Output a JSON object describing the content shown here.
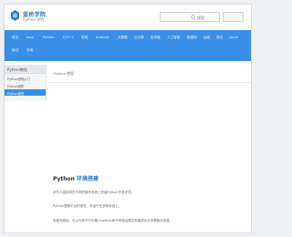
{
  "header": {
    "logo_cn": "蓝桥学院",
    "logo_en": "Python 学院",
    "search_placeholder": "搜索",
    "search_button": ""
  },
  "nav": {
    "items": [
      "首页",
      "Java",
      "Python",
      "C/C++",
      "前端",
      "Android",
      "大数据",
      "云计算",
      "区块链",
      "人工智能",
      "数据库",
      "运维",
      "测试",
      "Linux",
      "面试",
      "其他"
    ]
  },
  "sidebar": {
    "title": "Python教程",
    "items": [
      "Python基础入门",
      "Python进阶",
      "Python爬虫"
    ]
  },
  "breadcrumb": "Python 教程",
  "article": {
    "title_prefix": "Python",
    "title_highlight": "环境搭建",
    "lines": [
      "本节介绍如何在不同的操作系统上安装Python开发环境。",
      "Python是跨平台的语言，可运行在多种系统上。",
      "安装完成后，可以在命令行中输入python命令来验证是否安装成功并查看版本信息。"
    ]
  },
  "colors": {
    "accent": "#3a8ee6",
    "logo": "#2f78c7"
  }
}
